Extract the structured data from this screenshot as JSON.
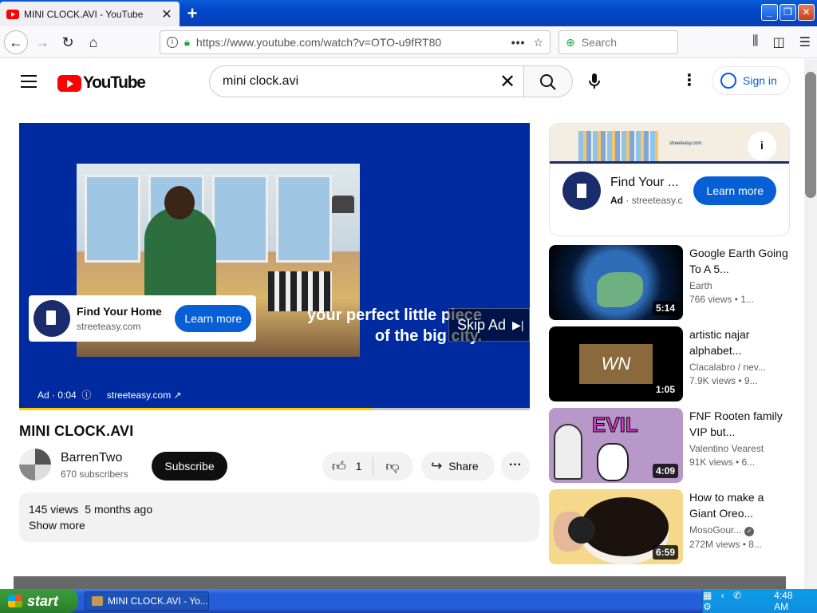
{
  "browser": {
    "tab_title": "MINI CLOCK.AVI - YouTube",
    "tab_close": "✕",
    "new_tab": "+",
    "url": "https://www.youtube.com/watch?v=OTO-u9fRT80",
    "url_menu": "•••",
    "search_placeholder": "Search"
  },
  "youtube": {
    "logo_text": "YouTube",
    "search_query": "mini clock.avi",
    "sign_in": "Sign in"
  },
  "player_ad": {
    "card_title": "Find Your Home",
    "card_domain": "streeteasy.com",
    "learn_more": "Learn more",
    "tagline_line1": "your perfect little piece",
    "tagline_line2": "of the big city.",
    "skip_label": "Skip Ad",
    "ad_time": "Ad · 0:04",
    "ad_site": "streeteasy.com ↗",
    "progress_fraction": 0.69
  },
  "video": {
    "title": "MINI CLOCK.AVI",
    "channel": "BarrenTwo",
    "subscribers": "670 subscribers",
    "subscribe": "Subscribe",
    "likes": "1",
    "share": "Share",
    "views": "145 views",
    "age": "5 months ago",
    "show_more": "Show more"
  },
  "side_ad": {
    "banner_brand": "streeteasy.com",
    "title": "Find Your ...",
    "ad_label": "Ad",
    "domain": "streeteasy.c",
    "learn_more": "Learn more"
  },
  "recommendations": [
    {
      "title": "Google Earth Going To A 5...",
      "channel": "Earth",
      "meta": "766 views • 1...",
      "duration": "5:14"
    },
    {
      "title": "artistic najar alphabet...",
      "channel": "Clacalabro / nev...",
      "meta": "7.9K views • 9...",
      "duration": "1:05",
      "thumb_text": "WN"
    },
    {
      "title": "FNF Rooten family VIP but...",
      "channel": "Valentino Vearest",
      "meta": "91K views • 6...",
      "duration": "4:09",
      "thumb_text": "EVIL"
    },
    {
      "title": "How to make a Giant Oreo...",
      "channel": "MosoGour...",
      "meta": "272M views • 8...",
      "duration": "6:59",
      "verified": true
    }
  ],
  "taskbar": {
    "start": "start",
    "task": "MINI CLOCK.AVI - Yo...",
    "clock": "4:48 AM"
  },
  "icons": [
    "youtube-favicon",
    "back-arrow",
    "forward-arrow",
    "reload",
    "home",
    "info",
    "lock",
    "bookmark-star",
    "library",
    "sidebar",
    "hamburger",
    "search",
    "microphone",
    "kebab",
    "account",
    "like",
    "dislike",
    "share",
    "more"
  ],
  "colors": {
    "yt_red": "#ff0000",
    "link_blue": "#065fd4",
    "ad_blue": "#002aa0",
    "ad_progress": "#ffcc00"
  }
}
